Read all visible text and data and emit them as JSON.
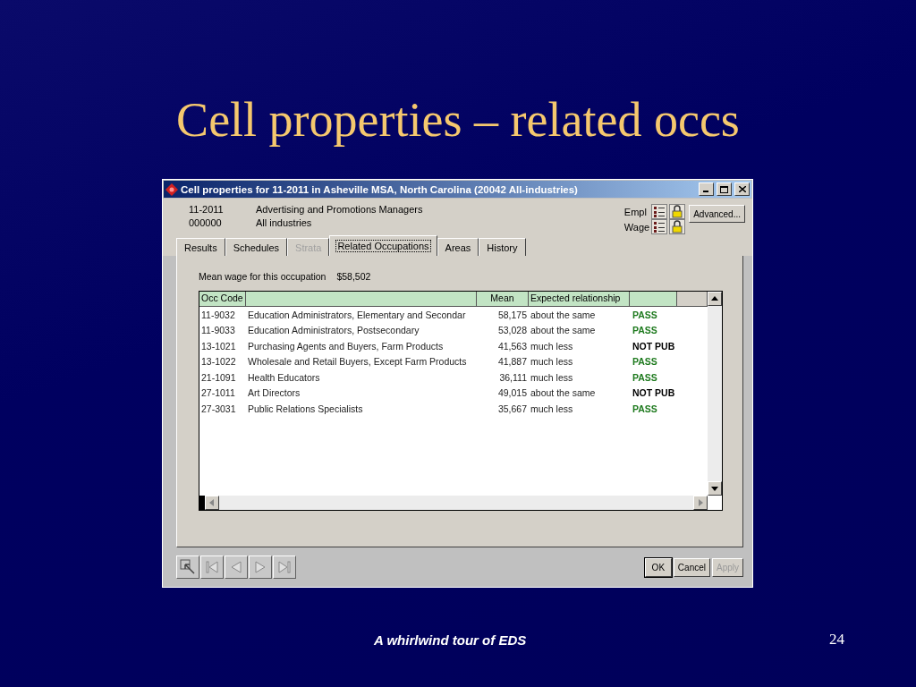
{
  "slide": {
    "title": "Cell properties – related occs",
    "footer": "A whirlwind tour of EDS",
    "page_number": "24"
  },
  "window": {
    "title": "Cell properties for 11-2011 in Asheville MSA, North Carolina (20042 All-industries)",
    "info": [
      {
        "code": "11-2011",
        "name": "Advertising and Promotions Managers",
        "measure": "Empl"
      },
      {
        "code": "000000",
        "name": "All industries",
        "measure": "Wage"
      }
    ],
    "advanced_button": "Advanced...",
    "tabs": [
      {
        "label": "Results",
        "selected": false,
        "disabled": false
      },
      {
        "label": "Schedules",
        "selected": false,
        "disabled": false
      },
      {
        "label": "Strata",
        "selected": false,
        "disabled": true
      },
      {
        "label": "Related Occupations",
        "selected": true,
        "disabled": false
      },
      {
        "label": "Areas",
        "selected": false,
        "disabled": false
      },
      {
        "label": "History",
        "selected": false,
        "disabled": false
      }
    ],
    "mean_wage_label": "Mean wage for this occupation",
    "mean_wage_value": "$58,502",
    "table": {
      "columns": [
        "Occ Code",
        "Mean",
        "Expected relationship"
      ],
      "rows": [
        {
          "code": "11-9032",
          "title": "Education Administrators, Elementary and Secondar",
          "mean": "58,175",
          "relationship": "about the same",
          "status": "PASS",
          "color": "#1e7a1e"
        },
        {
          "code": "11-9033",
          "title": "Education Administrators, Postsecondary",
          "mean": "53,028",
          "relationship": "about the same",
          "status": "PASS",
          "color": "#1e7a1e"
        },
        {
          "code": "13-1021",
          "title": "Purchasing Agents and Buyers, Farm Products",
          "mean": "41,563",
          "relationship": "much less",
          "status": "NOT PUB",
          "color": "#000000"
        },
        {
          "code": "13-1022",
          "title": "Wholesale and Retail Buyers, Except Farm Products",
          "mean": "41,887",
          "relationship": "much less",
          "status": "PASS",
          "color": "#1e7a1e"
        },
        {
          "code": "21-1091",
          "title": "Health Educators",
          "mean": "36,111",
          "relationship": "much less",
          "status": "PASS",
          "color": "#1e7a1e"
        },
        {
          "code": "27-1011",
          "title": "Art Directors",
          "mean": "49,015",
          "relationship": "about the same",
          "status": "NOT PUB",
          "color": "#000000"
        },
        {
          "code": "27-3031",
          "title": "Public Relations Specialists",
          "mean": "35,667",
          "relationship": "much less",
          "status": "PASS",
          "color": "#1e7a1e"
        }
      ]
    },
    "buttons": [
      {
        "label": "OK",
        "disabled": false
      },
      {
        "label": "Cancel",
        "disabled": false
      },
      {
        "label": "Apply",
        "disabled": true
      }
    ]
  }
}
